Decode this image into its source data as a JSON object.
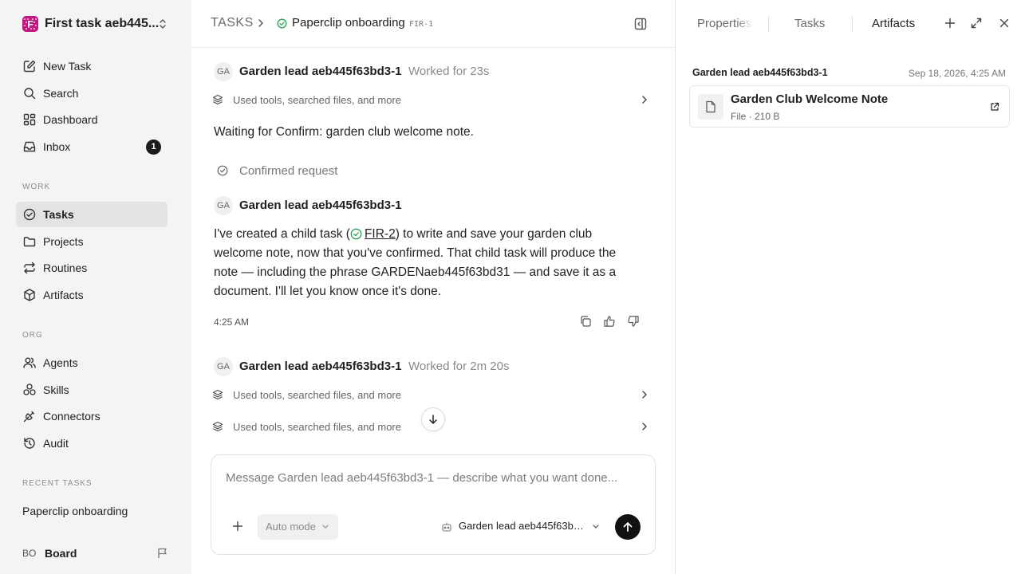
{
  "workspace": {
    "name": "First task aeb445...",
    "logo_letter": "F"
  },
  "sidebar": {
    "top_items": [
      {
        "label": "New Task"
      },
      {
        "label": "Search"
      },
      {
        "label": "Dashboard"
      },
      {
        "label": "Inbox",
        "badge": "1"
      }
    ],
    "work_label": "WORK",
    "work_items": [
      {
        "label": "Tasks",
        "active": true
      },
      {
        "label": "Projects"
      },
      {
        "label": "Routines"
      },
      {
        "label": "Artifacts"
      }
    ],
    "org_label": "ORG",
    "org_items": [
      {
        "label": "Agents"
      },
      {
        "label": "Skills"
      },
      {
        "label": "Connectors"
      },
      {
        "label": "Audit"
      }
    ],
    "recent_label": "RECENT TASKS",
    "recent_items": [
      {
        "label": "Paperclip onboarding"
      }
    ],
    "board": {
      "initials": "BO",
      "label": "Board"
    }
  },
  "header": {
    "root": "TASKS",
    "title": "Paperclip onboarding",
    "task_id": "FIR-1"
  },
  "thread": {
    "author_initials": "GA",
    "author_name": "Garden lead aeb445f63bd3-1",
    "messages": [
      {
        "worked": "Worked for 23s",
        "tool_rows": [
          "Used tools, searched files, and more"
        ],
        "text": "Waiting for Confirm: garden club welcome note."
      }
    ],
    "confirmed_label": "Confirmed request",
    "reply": {
      "text_before": "I've created a child task (",
      "link": "FIR-2",
      "text_after": ") to write and save your garden club welcome note, now that you've confirmed. That child task will produce the note — including the phrase GARDENaeb445f63bd31 — and save it as a document. I'll let you know once it's done.",
      "time": "4:25 AM"
    },
    "last_message": {
      "worked": "Worked for 2m 20s",
      "tool_rows": [
        "Used tools, searched files, and more",
        "Used tools, searched files, and more"
      ]
    }
  },
  "composer": {
    "placeholder": "Message Garden lead aeb445f63bd3-1 — describe what you want done...",
    "mode": "Auto mode",
    "agent": "Garden lead aeb445f63bd3-1"
  },
  "right_panel": {
    "tabs": [
      {
        "label": "Properties"
      },
      {
        "label": "Tasks"
      },
      {
        "label": "Artifacts",
        "active": true
      }
    ],
    "artifact": {
      "author": "Garden lead aeb445f63bd3-1",
      "date": "Sep 18, 2026, 4:25 AM",
      "title": "Garden Club Welcome Note",
      "meta": "File · 210 B"
    }
  },
  "colors": {
    "logo": "#c2177f",
    "status_green": "#2e9e55",
    "send": "#111111",
    "sidebar_bg": "#f4f4f4"
  }
}
